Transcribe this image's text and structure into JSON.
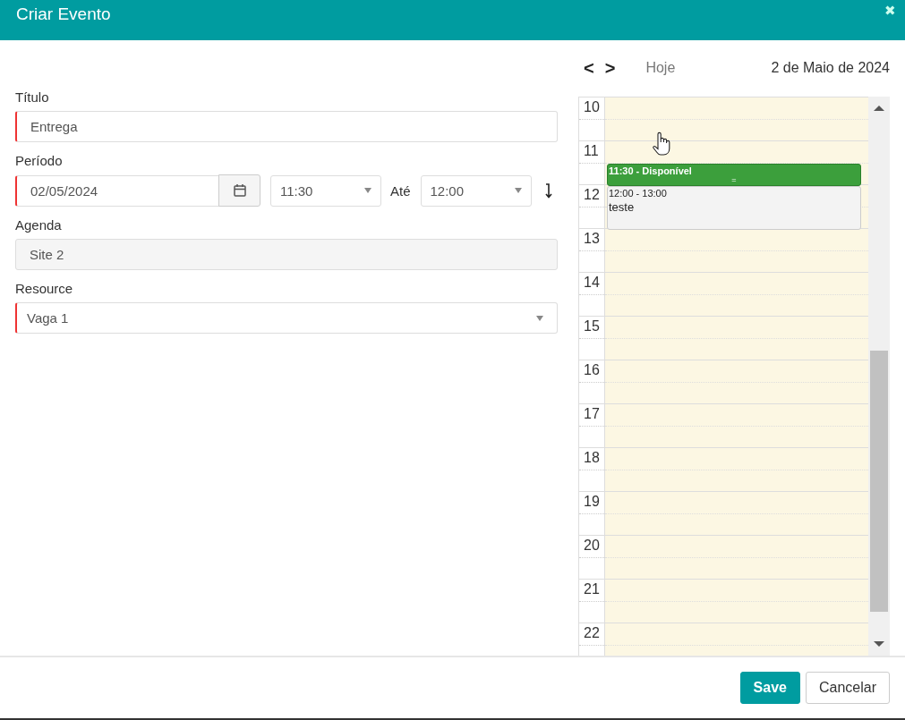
{
  "window": {
    "title": "Criar Evento",
    "close": "✖"
  },
  "form": {
    "fields": [
      {
        "kind": "text",
        "label": "Título",
        "value": "Entrega",
        "required": true
      },
      {
        "kind": "period",
        "label": "Período",
        "date": "02/05/2024",
        "start": "11:30",
        "between": "Até",
        "end": "12:00",
        "required": true
      },
      {
        "kind": "readonly",
        "label": "Agenda",
        "value": "Site 2",
        "required": false
      },
      {
        "kind": "select",
        "label": "Resource",
        "value": "Vaga 1",
        "required": true
      }
    ]
  },
  "calendar": {
    "nav": {
      "prev": "<",
      "next": ">",
      "today": "Hoje"
    },
    "date": "2 de Maio de 2024",
    "hours": [
      "10",
      "11",
      "12",
      "13",
      "14",
      "15",
      "16",
      "17",
      "18",
      "19",
      "20",
      "21",
      "22"
    ],
    "events": [
      {
        "kind": "available",
        "title": "11:30 - Disponível",
        "handle": "="
      },
      {
        "kind": "booked",
        "time": "12:00 - 13:00",
        "title": "teste"
      }
    ]
  },
  "buttons": [
    {
      "kind": "primary",
      "label": "Save"
    },
    {
      "kind": "secondary",
      "label": "Cancelar"
    }
  ]
}
